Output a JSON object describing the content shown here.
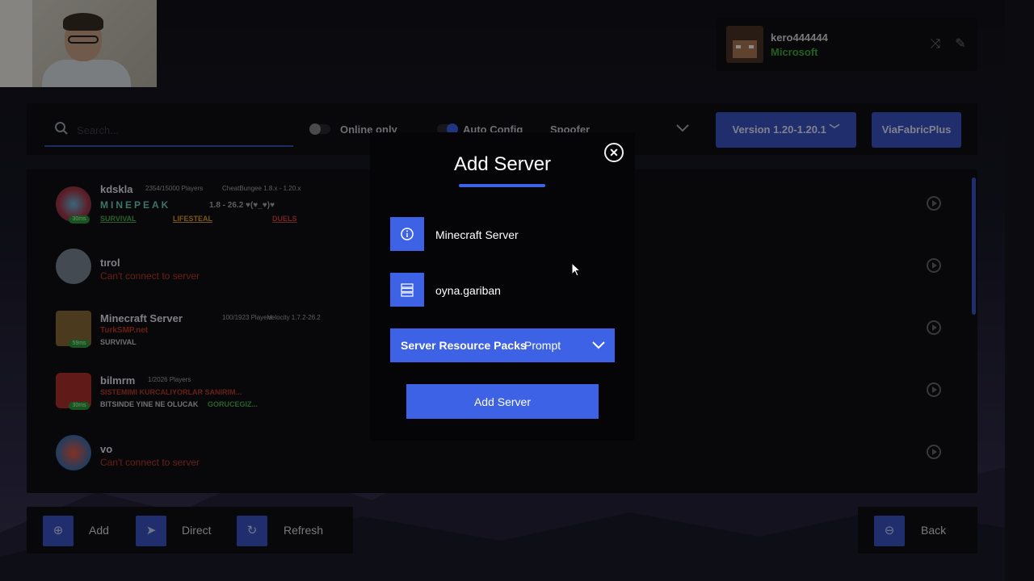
{
  "account": {
    "name": "kero444444",
    "type": "Microsoft"
  },
  "filters": {
    "search_placeholder": "Search...",
    "online_only": "Online only",
    "auto_config": "Auto Config",
    "spoofer": "Spoofer",
    "version": "Version 1.20-1.20.1",
    "viafabric": "ViaFabricPlus"
  },
  "servers": [
    {
      "name": "kdskla",
      "players": "2354/15000 Players",
      "version": "CheatBungee 1.8.x - 1.20.x",
      "motd1": "MINEPEAK",
      "motd1_tail": "1.8 - 26.2 ♥(♥_♥)♥",
      "motd2": [
        "SURVIVAL",
        "LIFESTEAL",
        "DUELS"
      ],
      "badge": "30ms",
      "badge_color": "#2a9a3a"
    },
    {
      "name": "tırol",
      "status": "Can't connect to server"
    },
    {
      "name": "Minecraft Server",
      "players": "100/1923 Players",
      "version": "Velocity 1.7.2-26.2",
      "motd1": "TurkSMP.net",
      "motd2_text": "SURVIVAL",
      "badge": "59ms"
    },
    {
      "name": "bilmrm",
      "players": "1/2026 Players",
      "motd1": "SISTEMIMI KURCALIYORLAR SANIRIM...",
      "motd2_text": "BITSINDE YINE NE OLUCAK",
      "motd2_accent": "GORUCEGIZ...",
      "badge": "30ms"
    },
    {
      "name": "vo",
      "status": "Can't connect to server"
    }
  ],
  "bottom": {
    "add": "Add",
    "direct": "Direct",
    "refresh": "Refresh",
    "back": "Back"
  },
  "modal": {
    "title": "Add Server",
    "name_value": "Minecraft Server",
    "address_value": "oyna.gariban",
    "packs_bold": "Server Resource Packs",
    "packs_value": "Prompt",
    "submit": "Add Server"
  },
  "colors": {
    "accent": "#3d62e6",
    "success": "#3fae3a",
    "error": "#c0392b"
  }
}
